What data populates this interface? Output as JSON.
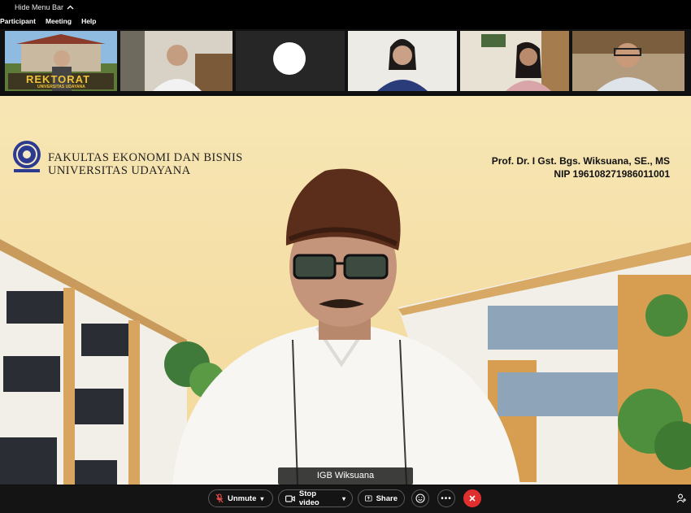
{
  "menu_bar": {
    "hide_label": "Hide Menu Bar",
    "items": [
      "Participant",
      "Meeting",
      "Help"
    ]
  },
  "gallery": {
    "banner_text": "REKTORAT",
    "banner_sub": "UNIVERSITAS UDAYANA"
  },
  "slide": {
    "faculty_line1": "FAKULTAS EKONOMI DAN BISNIS",
    "faculty_line2": "UNIVERSITAS UDAYANA",
    "presenter_name": "Prof. Dr. I Gst. Bgs. Wiksuana, SE., MS",
    "presenter_nip": "NIP 196108271986011001"
  },
  "speaker": {
    "name": "IGB Wiksuana"
  },
  "controls": {
    "unmute": "Unmute",
    "stop_video": "Stop video",
    "share": "Share"
  },
  "colors": {
    "leave": "#e02f2f",
    "bar": "#141414",
    "slide_bg": "#f6e2ae"
  }
}
